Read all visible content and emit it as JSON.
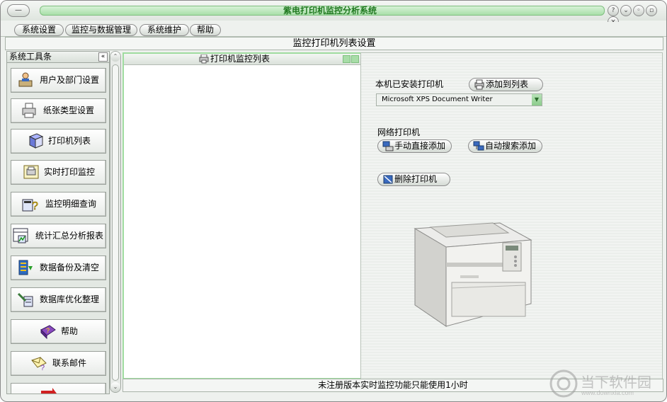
{
  "window": {
    "title": "紫电打印机监控分析系统",
    "controls": [
      "help",
      "minimize",
      "maximize",
      "close"
    ]
  },
  "menu": [
    "系统设置",
    "监控与数据管理",
    "系统维护",
    "帮助"
  ],
  "page_header": "监控打印机列表设置",
  "toolbox": {
    "title": "系统工具条",
    "items": [
      {
        "label": "用户及部门设置",
        "icon": "user-at-desk-icon"
      },
      {
        "label": "纸张类型设置",
        "icon": "printer-paper-icon"
      },
      {
        "label": "打印机列表",
        "icon": "printer-cube-icon"
      },
      {
        "label": "实时打印监控",
        "icon": "printer-monitor-icon"
      },
      {
        "label": "监控明细查询",
        "icon": "calculator-question-icon"
      },
      {
        "label": "统计汇总分析报表",
        "icon": "spreadsheet-chart-icon"
      },
      {
        "label": "数据备份及清空",
        "icon": "database-backup-icon"
      },
      {
        "label": "数据库优化整理",
        "icon": "database-tools-icon"
      },
      {
        "label": "帮助",
        "icon": "help-book-icon"
      },
      {
        "label": "联系邮件",
        "icon": "mail-envelope-icon"
      }
    ]
  },
  "list_panel": {
    "title": "打印机监控列表"
  },
  "installed": {
    "label": "本机已安装打印机",
    "add_button": "添加到列表",
    "selected_printer": "Microsoft XPS Document Writer"
  },
  "network": {
    "label": "网络打印机",
    "manual_add_button": "手动直接添加",
    "auto_search_button": "自动搜索添加"
  },
  "delete_button": "删除打印机",
  "status_bar": "未注册版本实时监控功能只能使用1小时",
  "watermark": {
    "text": "当下软件园",
    "url": "www.downxia.com"
  },
  "colors": {
    "title_text": "#217a21",
    "title_track": "#b8e6b8",
    "panel_border": "#9fdc9f"
  }
}
